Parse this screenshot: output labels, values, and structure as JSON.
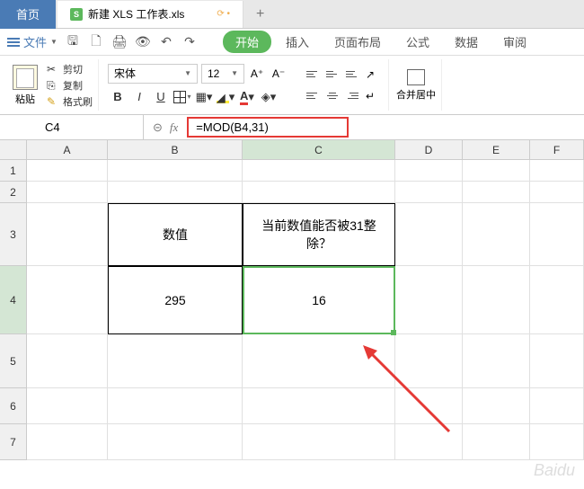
{
  "tabs": {
    "home": "首页",
    "docIcon": "S",
    "docName": "新建 XLS 工作表.xls"
  },
  "file": {
    "label": "文件"
  },
  "ribbon": {
    "start": "开始",
    "insert": "插入",
    "pageLayout": "页面布局",
    "formula": "公式",
    "data": "数据",
    "review": "审阅"
  },
  "clipboard": {
    "paste": "粘贴",
    "cut": "剪切",
    "copy": "复制",
    "formatPainter": "格式刷"
  },
  "font": {
    "name": "宋体",
    "size": "12",
    "bold": "B",
    "italic": "I",
    "underline": "U",
    "fontColorLetter": "A"
  },
  "merge": {
    "label": "合并居中"
  },
  "nameBox": "C4",
  "formula": "=MOD(B4,31)",
  "colHeaders": [
    "A",
    "B",
    "C",
    "D",
    "E",
    "F"
  ],
  "rowHeaders": [
    "1",
    "2",
    "3",
    "4",
    "5",
    "6",
    "7"
  ],
  "cells": {
    "B3": "数值",
    "C3": "当前数值能否被31整除？",
    "B4": "295",
    "C4": "16"
  },
  "watermark": "Baidu"
}
